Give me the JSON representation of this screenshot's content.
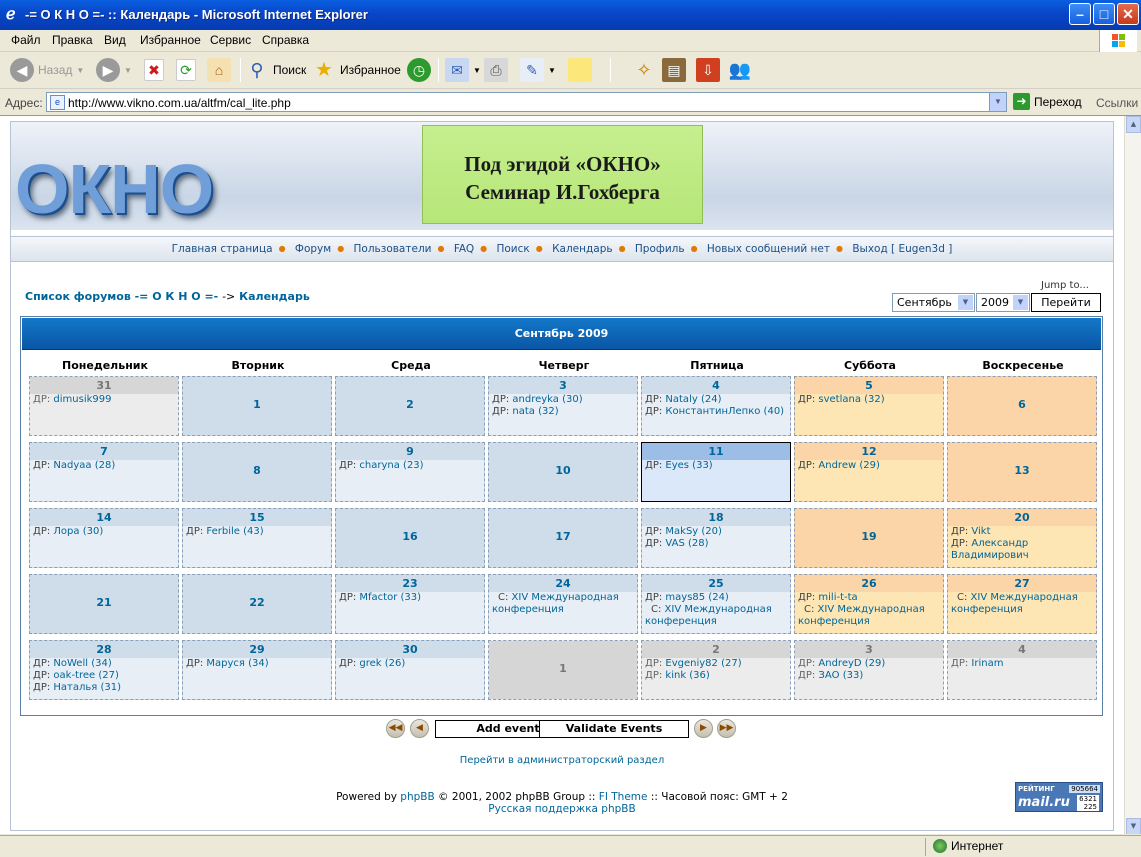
{
  "window": {
    "title": "-= О К Н О =- :: Календарь - Microsoft Internet Explorer"
  },
  "menu": [
    "Файл",
    "Правка",
    "Вид",
    "Избранное",
    "Сервис",
    "Справка"
  ],
  "toolbar": {
    "back": "Назад",
    "search": "Поиск",
    "favorites": "Избранное"
  },
  "address": {
    "label": "Адрес:",
    "url": "http://www.vikno.com.ua/altfm/cal_lite.php",
    "go": "Переход",
    "links": "Ссылки"
  },
  "site": {
    "logo": "ОКНО",
    "seminar_line1": "Под эгидой «ОКНО»",
    "seminar_line2": "Семинар И.Гохберга",
    "nav": [
      "Главная страница",
      "Форум",
      "Пользователи",
      "FAQ",
      "Поиск",
      "Календарь",
      "Профиль",
      "Новых сообщений нет",
      "Выход [ Eugen3d ]"
    ],
    "crumb_forums": "Список форумов -= О К Н О =-",
    "crumb_sep": "->",
    "crumb_calendar": "Календарь",
    "jump_to": "Jump to...",
    "month_select": "Сентябрь",
    "year_select": "2009",
    "go_button": "Перейти",
    "admin_link": "Перейти в администраторский раздел",
    "powered_by": "Powered by",
    "phpbb": "phpBB",
    "powered_rest": "© 2001, 2002 phpBB Group ::",
    "theme": "FI Theme",
    "tz": ":: Часовой пояс: GMT + 2",
    "ru_support": "Русская поддержка phpBB",
    "rating_label": "РЕЙТИНГ",
    "rating_value": "905664",
    "rating_brand": "mail.ru",
    "rating_n1": "6321",
    "rating_n2": "225"
  },
  "calendar": {
    "header": "Сентябрь 2009",
    "days_of_week": [
      "Понедельник",
      "Вторник",
      "Среда",
      "Четверг",
      "Пятница",
      "Суббота",
      "Воскресенье"
    ],
    "add_event": "Add event",
    "validate_events": "Validate Events",
    "weeks": [
      [
        {
          "day": "31",
          "type": "other",
          "events": [
            {
              "p": "ДР:",
              "n": "dimusik999"
            }
          ]
        },
        {
          "day": "1",
          "type": "cur",
          "events": []
        },
        {
          "day": "2",
          "type": "cur",
          "events": []
        },
        {
          "day": "3",
          "type": "cur",
          "events": [
            {
              "p": "ДР:",
              "n": "andreyka (30)"
            },
            {
              "p": "ДР:",
              "n": "nata (32)"
            }
          ]
        },
        {
          "day": "4",
          "type": "cur",
          "events": [
            {
              "p": "ДР:",
              "n": "Nataly (24)"
            },
            {
              "p": "ДР:",
              "n": "КонстантинЛепко (40)"
            }
          ]
        },
        {
          "day": "5",
          "type": "wknd",
          "events": [
            {
              "p": "ДР:",
              "n": "svetlana (32)"
            }
          ]
        },
        {
          "day": "6",
          "type": "wknd",
          "events": []
        }
      ],
      [
        {
          "day": "7",
          "type": "cur",
          "events": [
            {
              "p": "ДР:",
              "n": "Nadyaa (28)"
            }
          ]
        },
        {
          "day": "8",
          "type": "cur",
          "events": []
        },
        {
          "day": "9",
          "type": "cur",
          "events": [
            {
              "p": "ДР:",
              "n": "charyna (23)"
            }
          ]
        },
        {
          "day": "10",
          "type": "cur",
          "events": []
        },
        {
          "day": "11",
          "type": "today",
          "events": [
            {
              "p": "ДР:",
              "n": "Eyes (33)"
            }
          ]
        },
        {
          "day": "12",
          "type": "wknd",
          "events": [
            {
              "p": "ДР:",
              "n": "Andrew (29)"
            }
          ]
        },
        {
          "day": "13",
          "type": "wknd",
          "events": []
        }
      ],
      [
        {
          "day": "14",
          "type": "cur",
          "events": [
            {
              "p": "ДР:",
              "n": "Лора (30)"
            }
          ]
        },
        {
          "day": "15",
          "type": "cur",
          "events": [
            {
              "p": "ДР:",
              "n": "Ferbile (43)"
            }
          ]
        },
        {
          "day": "16",
          "type": "cur",
          "events": []
        },
        {
          "day": "17",
          "type": "cur",
          "events": []
        },
        {
          "day": "18",
          "type": "cur",
          "events": [
            {
              "p": "ДР:",
              "n": "MakSy (20)"
            },
            {
              "p": "ДР:",
              "n": "VAS (28)"
            }
          ]
        },
        {
          "day": "19",
          "type": "wknd",
          "events": []
        },
        {
          "day": "20",
          "type": "wknd",
          "events": [
            {
              "p": "ДР:",
              "n": "Vikt"
            },
            {
              "p": "ДР:",
              "n": "Александр Владимирович"
            }
          ]
        }
      ],
      [
        {
          "day": "21",
          "type": "cur",
          "events": []
        },
        {
          "day": "22",
          "type": "cur",
          "events": []
        },
        {
          "day": "23",
          "type": "cur",
          "events": [
            {
              "p": "ДР:",
              "n": "Mfactor (33)"
            }
          ]
        },
        {
          "day": "24",
          "type": "cur",
          "events": [
            {
              "p": "С:",
              "n": "XIV Международная конференция"
            }
          ]
        },
        {
          "day": "25",
          "type": "cur",
          "events": [
            {
              "p": "ДР:",
              "n": "mays85 (24)"
            },
            {
              "p": "С:",
              "n": "XIV Международная конференция"
            }
          ]
        },
        {
          "day": "26",
          "type": "wknd",
          "events": [
            {
              "p": "ДР:",
              "n": "mili-t-ta"
            },
            {
              "p": "С:",
              "n": "XIV Международная конференция"
            }
          ]
        },
        {
          "day": "27",
          "type": "wknd",
          "events": [
            {
              "p": "С:",
              "n": "XIV Международная конференция"
            }
          ]
        }
      ],
      [
        {
          "day": "28",
          "type": "cur",
          "events": [
            {
              "p": "ДР:",
              "n": "NoWell (34)"
            },
            {
              "p": "ДР:",
              "n": "oak-tree (27)"
            },
            {
              "p": "ДР:",
              "n": "Наталья (31)"
            }
          ]
        },
        {
          "day": "29",
          "type": "cur",
          "events": [
            {
              "p": "ДР:",
              "n": "Маруся (34)"
            }
          ]
        },
        {
          "day": "30",
          "type": "cur",
          "events": [
            {
              "p": "ДР:",
              "n": "grek (26)"
            }
          ]
        },
        {
          "day": "1",
          "type": "other",
          "events": []
        },
        {
          "day": "2",
          "type": "other",
          "events": [
            {
              "p": "ДР:",
              "n": "Evgeniy82 (27)"
            },
            {
              "p": "ДР:",
              "n": "kink (36)"
            }
          ]
        },
        {
          "day": "3",
          "type": "other",
          "events": [
            {
              "p": "ДР:",
              "n": "AndreyD (29)"
            },
            {
              "p": "ДР:",
              "n": "ЗАО (33)"
            }
          ]
        },
        {
          "day": "4",
          "type": "other",
          "events": [
            {
              "p": "ДР:",
              "n": "Irinam"
            }
          ]
        }
      ]
    ]
  },
  "status": {
    "zone": "Интернет"
  }
}
